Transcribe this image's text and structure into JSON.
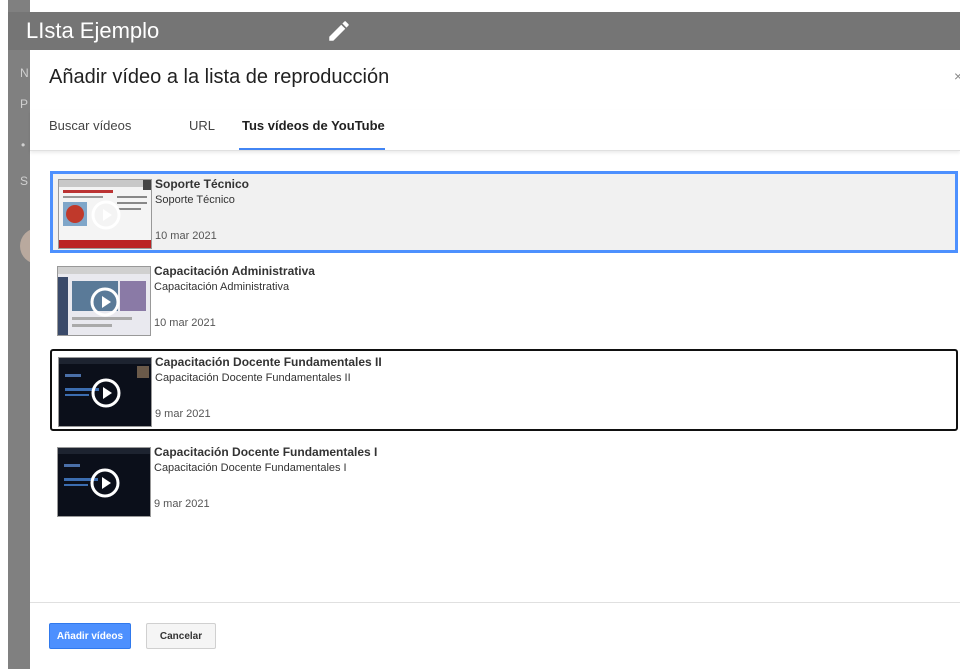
{
  "background": {
    "app_title": "LIsta Ejemplo",
    "letters": [
      "N",
      "P",
      "•",
      "S"
    ]
  },
  "dialog": {
    "title": "Añadir vídeo a la lista de reproducción",
    "close": "×",
    "tabs": [
      {
        "label": "Buscar vídeos",
        "active": false
      },
      {
        "label": "URL",
        "active": false
      },
      {
        "label": "Tus vídeos de YouTube",
        "active": true
      }
    ],
    "videos": [
      {
        "title": "Soporte Técnico",
        "description": "Soporte Técnico",
        "date": "10 mar 2021",
        "state": "selected"
      },
      {
        "title": "Capacitación Administrativa",
        "description": "Capacitación Administrativa",
        "date": "10 mar 2021",
        "state": "normal"
      },
      {
        "title": "Capacitación Docente Fundamentales II",
        "description": "Capacitación Docente Fundamentales II",
        "date": "9 mar 2021",
        "state": "focused"
      },
      {
        "title": "Capacitación Docente Fundamentales I",
        "description": "Capacitación Docente Fundamentales I",
        "date": "9 mar 2021",
        "state": "normal"
      }
    ],
    "buttons": {
      "add": "Añadir vídeos",
      "cancel": "Cancelar"
    }
  },
  "colors": {
    "accent": "#4d90fe",
    "header": "#757575",
    "tab_underline": "#4285f4"
  }
}
